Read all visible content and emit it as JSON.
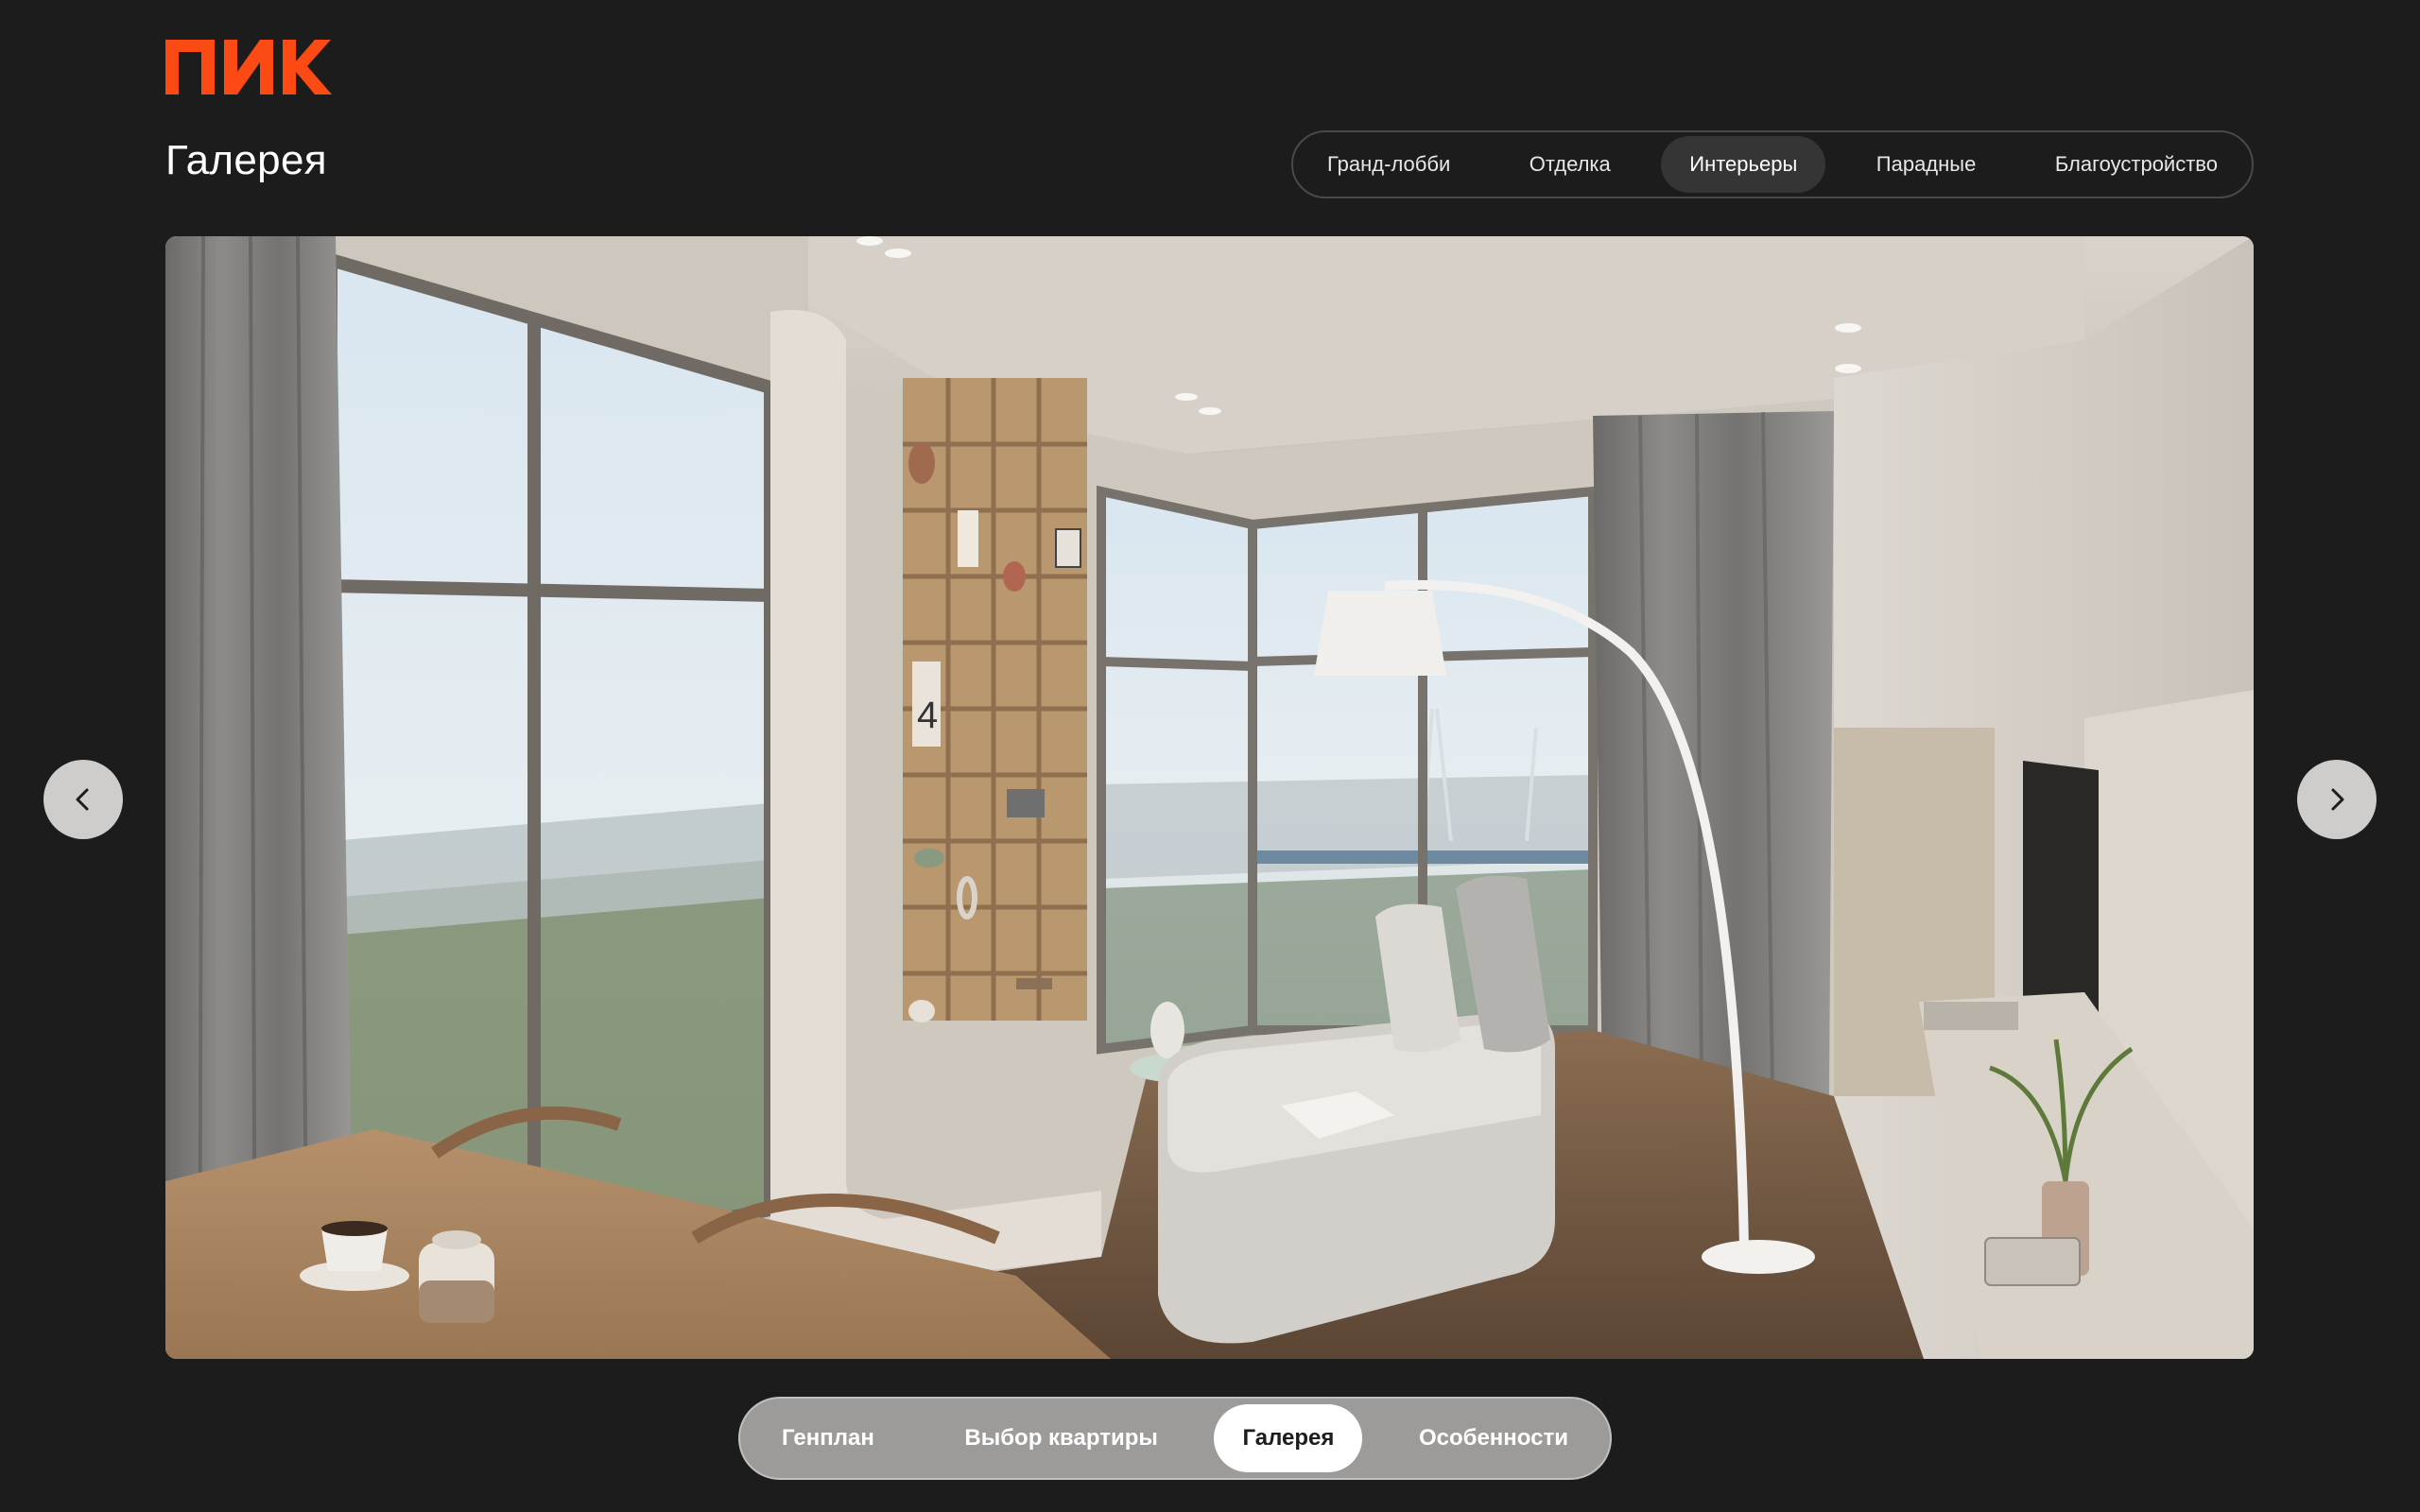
{
  "brand": {
    "logo_text": "ПИК",
    "accent_color": "#fb4a14"
  },
  "page": {
    "title": "Галерея"
  },
  "gallery_tabs": [
    {
      "label": "Гранд-лобби",
      "active": false
    },
    {
      "label": "Отделка",
      "active": false
    },
    {
      "label": "Интерьеры",
      "active": true
    },
    {
      "label": "Парадные",
      "active": false
    },
    {
      "label": "Благоустройство",
      "active": false
    }
  ],
  "carousel": {
    "prev_icon": "chevron-left-icon",
    "next_icon": "chevron-right-icon"
  },
  "section_nav": [
    {
      "label": "Генплан",
      "active": false
    },
    {
      "label": "Выбор квартиры",
      "active": false
    },
    {
      "label": "Галерея",
      "active": true
    },
    {
      "label": "Особенности",
      "active": false
    }
  ]
}
